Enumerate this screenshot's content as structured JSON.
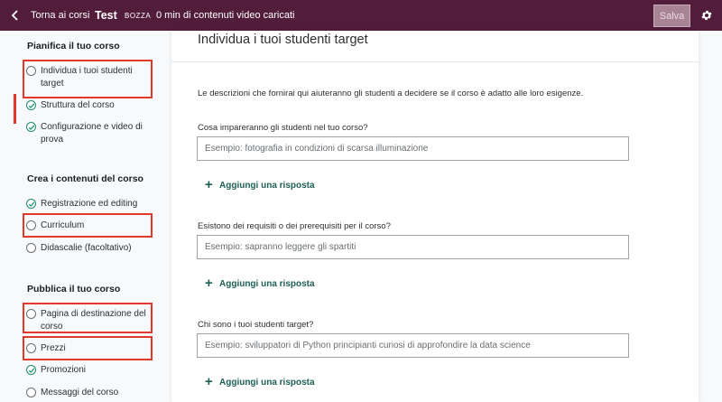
{
  "topbar": {
    "back_label": "Torna ai corsi",
    "course_title": "Test",
    "status_badge": "BOZZA",
    "video_info": "0 min di contenuti video caricati",
    "save_label": "Salva"
  },
  "sidebar": {
    "sections": [
      {
        "title": "Pianifica il tuo corso",
        "items": [
          {
            "label": "Individua i tuoi studenti target",
            "state": "empty"
          },
          {
            "label": "Struttura del corso",
            "state": "done"
          },
          {
            "label": "Configurazione e video di prova",
            "state": "done"
          }
        ]
      },
      {
        "title": "Crea i contenuti del corso",
        "items": [
          {
            "label": "Registrazione ed editing",
            "state": "done"
          },
          {
            "label": "Curriculum",
            "state": "empty"
          },
          {
            "label": "Didascalie (facoltativo)",
            "state": "empty"
          }
        ]
      },
      {
        "title": "Pubblica il tuo corso",
        "items": [
          {
            "label": "Pagina di destinazione del corso",
            "state": "empty"
          },
          {
            "label": "Prezzi",
            "state": "empty"
          },
          {
            "label": "Promozioni",
            "state": "done"
          },
          {
            "label": "Messaggi del corso",
            "state": "empty"
          }
        ]
      }
    ]
  },
  "main": {
    "title": "Individua i tuoi studenti target",
    "intro": "Le descrizioni che fornirai qui aiuteranno gli studenti a decidere se il corso è adatto alle loro esigenze.",
    "questions": [
      {
        "label": "Cosa impareranno gli studenti nel tuo corso?",
        "placeholder": "Esempio: fotografia in condizioni di scarsa illuminazione",
        "value": "",
        "add_label": "Aggiungi una risposta"
      },
      {
        "label": "Esistono dei requisiti o dei prerequisiti per il corso?",
        "placeholder": "Esempio: sapranno leggere gli spartiti",
        "value": "",
        "add_label": "Aggiungi una risposta"
      },
      {
        "label": "Chi sono i tuoi studenti target?",
        "placeholder": "Esempio: sviluppatori di Python principianti curiosi di approfondire la data science",
        "value": "",
        "add_label": "Aggiungi una risposta"
      }
    ]
  },
  "colors": {
    "topbar": "#521c3b",
    "highlight": "#e0392b",
    "success": "#1e8e6a",
    "link": "#1e6055"
  },
  "icons": {
    "back": "chevron-left-icon",
    "settings": "gear-icon",
    "item_done": "check-circle-icon",
    "item_empty": "empty-circle-icon",
    "add": "plus-icon"
  }
}
